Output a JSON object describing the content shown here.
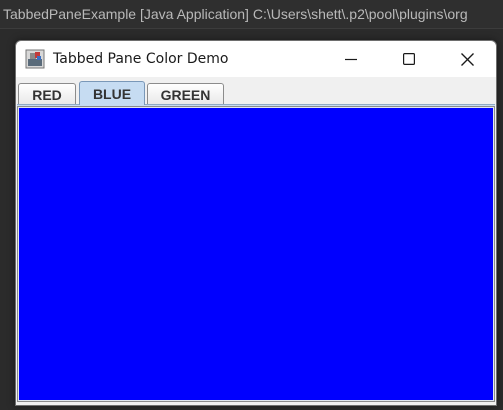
{
  "console": {
    "title": "TabbedPaneExample [Java Application] C:\\Users\\shett\\.p2\\pool\\plugins\\org"
  },
  "window": {
    "title": "Tabbed Pane Color Demo",
    "controls": [
      "minimize-icon",
      "maximize-icon",
      "close-icon"
    ]
  },
  "tabs": [
    {
      "label": "RED"
    },
    {
      "label": "BLUE"
    },
    {
      "label": "GREEN"
    }
  ],
  "selected_tab": "BLUE",
  "panel": {
    "color": "#0000ff"
  },
  "colors": {
    "selected_tab": "#c6dcf2",
    "console_bg": "#2f2f2f",
    "console_text": "#b9b9b9"
  }
}
